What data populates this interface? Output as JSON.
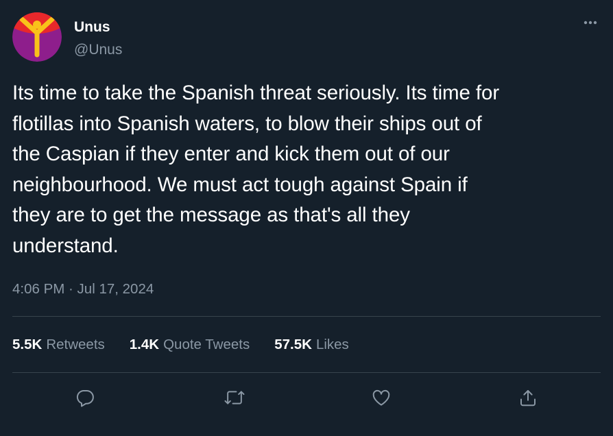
{
  "author": {
    "display_name": "Unus",
    "handle": "@Unus"
  },
  "tweet": {
    "text": "Its time to take the Spanish threat seriously. Its time for\nflotillas into Spanish waters, to blow their ships out of\nthe Caspian if they enter and kick them out of our\nneighbourhood. We must act tough against Spain if\nthey are to get the message as that's all they\nunderstand.",
    "timestamp": "4:06 PM · Jul 17, 2024"
  },
  "stats": {
    "retweets": {
      "count": "5.5K",
      "label": "Retweets"
    },
    "quote_tweets": {
      "count": "1.4K",
      "label": "Quote Tweets"
    },
    "likes": {
      "count": "57.5K",
      "label": "Likes"
    }
  },
  "actions": [
    "reply-icon",
    "retweet-icon",
    "like-icon",
    "share-icon"
  ],
  "colors": {
    "background": "#15202b",
    "text_primary": "#ffffff",
    "text_secondary": "#8b98a5",
    "divider": "#38444d",
    "avatar_bg": "#8e1e8c",
    "avatar_accent": "#f9c21a",
    "avatar_top": "#e8282b"
  }
}
